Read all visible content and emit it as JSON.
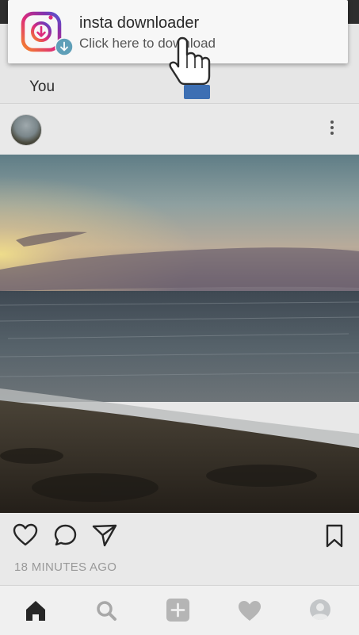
{
  "notification": {
    "app_name": "insta downloader",
    "message": "Click here to download",
    "icon": "insta-downloader-app-icon",
    "badge_icon": "download-arrow-icon",
    "cursor_icon": "hand-pointer-icon"
  },
  "header": {
    "tab_label": "You"
  },
  "post": {
    "author_avatar": "avatar",
    "menu_icon": "more-vertical-icon",
    "timestamp": "18 MINUTES AGO",
    "actions": [
      "heart-icon",
      "comment-icon",
      "share-icon",
      "bookmark-icon"
    ]
  },
  "bottom_nav": {
    "items": [
      "home-icon",
      "search-icon",
      "add-post-icon",
      "activity-heart-icon",
      "profile-icon"
    ],
    "active": "home-icon"
  },
  "colors": {
    "accent_gradient": [
      "#f58529",
      "#dd2a7b",
      "#8134af",
      "#515bd4"
    ],
    "badge": "#5f9fb8",
    "cursor_cuff": "#3d6fb3"
  }
}
